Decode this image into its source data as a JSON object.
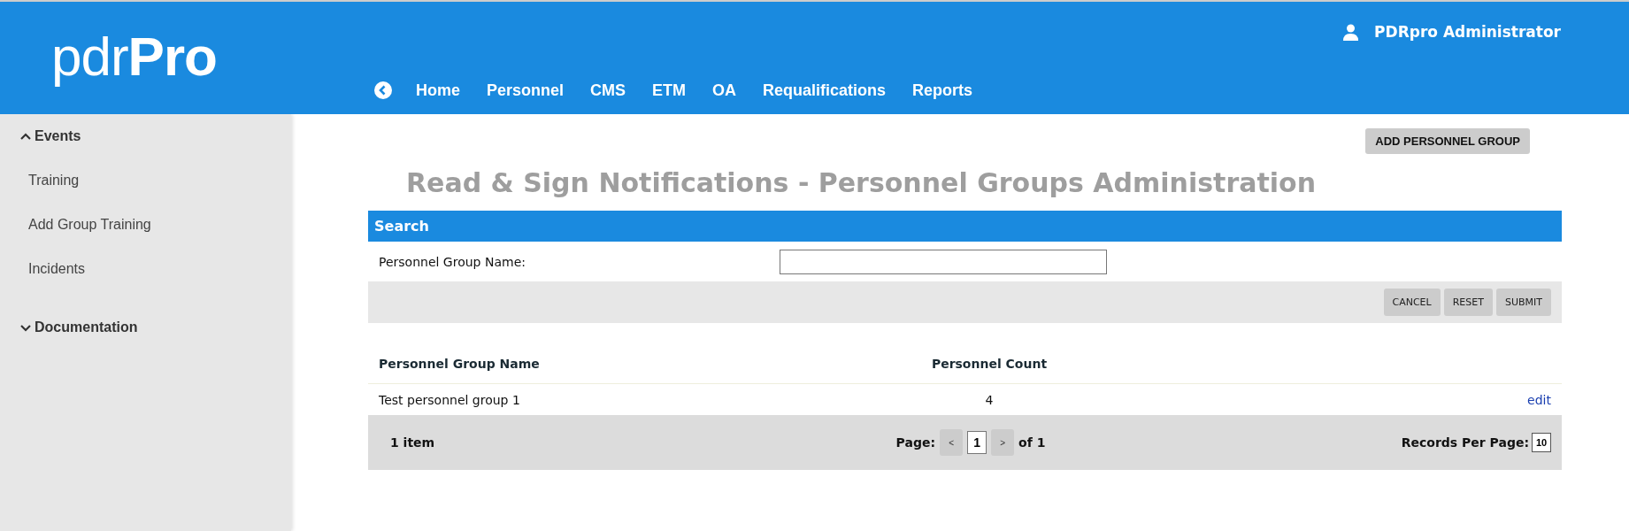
{
  "header": {
    "logo": {
      "light": "pdr",
      "bold": "Pro"
    },
    "user": "PDRpro Administrator",
    "nav": [
      {
        "label": "Home"
      },
      {
        "label": "Personnel"
      },
      {
        "label": "CMS"
      },
      {
        "label": "ETM"
      },
      {
        "label": "OA"
      },
      {
        "label": "Requalifications"
      },
      {
        "label": "Reports"
      }
    ]
  },
  "sidebar": {
    "items": [
      {
        "label": "Events",
        "expanded": true,
        "children": [
          {
            "label": "Training"
          },
          {
            "label": "Add Group Training"
          },
          {
            "label": "Incidents"
          }
        ]
      },
      {
        "label": "Documentation",
        "expanded": false
      }
    ]
  },
  "add_button": "ADD PERSONNEL GROUP",
  "title": "Read & Sign Notifications - Personnel Groups Administration",
  "search": {
    "heading": "Search",
    "field_label": "Personnel Group Name:",
    "buttons": [
      "CANCEL",
      "RESET",
      "SUBMIT"
    ]
  },
  "table": {
    "columns": [
      "Personnel Group Name",
      "Personnel Count"
    ],
    "rows": [
      {
        "name": "Test personnel group 1",
        "count": "4",
        "action": "edit"
      }
    ]
  },
  "pager": {
    "summary": "1 item",
    "page_label": "Page:",
    "prev": "<",
    "page": "1",
    "next": ">",
    "of": "of 1",
    "per_page_label": "Records Per Page:",
    "per_page": "10"
  }
}
